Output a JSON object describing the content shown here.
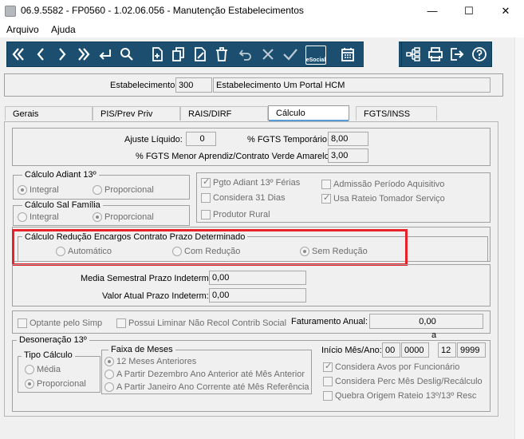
{
  "window": {
    "title": "06.9.5582 - FP0560 - 1.02.06.056 - Manutenção Estabelecimentos",
    "minimize": "—",
    "maximize": "☐",
    "close": "✕"
  },
  "menu": [
    "Arquivo",
    "Ajuda"
  ],
  "toolbar": {
    "esocial_label": "eSocial",
    "icons": [
      "first-icon",
      "prev-icon",
      "next-icon",
      "last-icon",
      "goto-icon",
      "search-icon",
      "add-icon",
      "copy-icon",
      "edit-icon",
      "delete-icon",
      "undo-icon",
      "cancel-icon",
      "confirm-icon",
      "esocial-icon",
      "calendar-icon",
      "tree-icon",
      "print-icon",
      "exit-icon",
      "help-icon"
    ]
  },
  "header": {
    "estab_label": "Estabelecimento:",
    "estab_code": "300",
    "estab_name": "Estabelecimento Um Portal HCM"
  },
  "tabs": [
    "Gerais",
    "PIS/Prev Priv",
    "RAIS/DIRF",
    "Cálculo",
    "FGTS/INSS"
  ],
  "active_tab": "Cálculo",
  "calc": {
    "ajuste_label": "Ajuste Líquido:",
    "ajuste_value": "0",
    "fgts_temp_label": "% FGTS Temporário:",
    "fgts_temp_value": "8,00",
    "fgts_menor_label": "% FGTS Menor Aprendiz/Contrato Verde Amarelo:",
    "fgts_menor_value": "3,00"
  },
  "adiant": {
    "title": "Cálculo Adiant 13º",
    "opt1": "Integral",
    "opt2": "Proporcional",
    "selected": "Integral"
  },
  "salfam": {
    "title": "Cálculo Sal Família",
    "opt1": "Integral",
    "opt2": "Proporcional",
    "selected": "Proporcional"
  },
  "checks": {
    "pgto_adiant": "Pgto Adiant 13º Férias",
    "considera31": "Considera 31 Dias",
    "produtor_rural": "Produtor Rural",
    "admissao": "Admissão Período Aquisitivo",
    "usa_rateio": "Usa Rateio Tomador Serviço"
  },
  "reducao": {
    "title": "Cálculo Redução Encargos Contrato Prazo Determinado",
    "opt1": "Automático",
    "opt2": "Com Redução",
    "opt3": "Sem Redução",
    "selected": "Sem Redução"
  },
  "prazo": {
    "media_label": "Media Semestral Prazo Indeterm:",
    "media_value": "0,00",
    "valor_label": "Valor Atual Prazo Indeterm:",
    "valor_value": "0,00"
  },
  "simples": {
    "optante": "Optante pelo Simp",
    "liminar": "Possui Liminar Não Recol Contrib Social",
    "fat_label": "Faturamento Anual:",
    "fat_value": "0,00"
  },
  "desoneracao": {
    "title": "Desoneração 13º",
    "tipo_title": "Tipo Cálculo",
    "tipo_opt1": "Média",
    "tipo_opt2": "Proporcional",
    "tipo_selected": "Proporcional",
    "faixa_title": "Faixa de Meses",
    "faixa_opt1": "12 Meses Anteriores",
    "faixa_opt2": "A Partir Dezembro Ano Anterior até Mês Anterior",
    "faixa_opt3": "A Partir Janeiro Ano Corrente até Mês Referência",
    "faixa_selected": "12 Meses Anteriores",
    "inicio_label": "Início Mês/Ano:",
    "a_label": "a",
    "mes_ini": "00",
    "ano_ini": "0000",
    "mes_fim": "12",
    "ano_fim": "9999",
    "chk_avos": "Considera Avos por Funcionário",
    "chk_perc": "Considera Perc Mês Deslig/Recálculo",
    "chk_quebra": "Quebra Origem Rateio 13º/13º Resc"
  }
}
